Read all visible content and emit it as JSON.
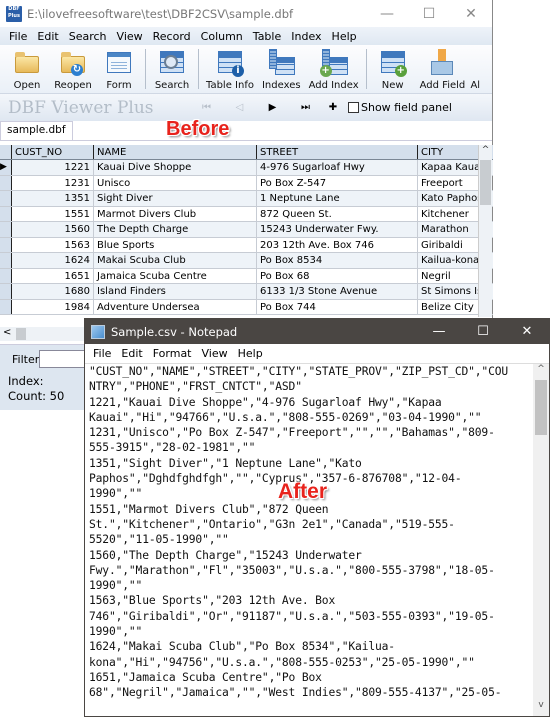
{
  "dbf_window": {
    "title": "E:\\ilovefreesoftware\\test\\DBF2CSV\\sample.dbf",
    "app_icon_text": "DBF Plus",
    "controls": {
      "minimize": "—",
      "maximize": "☐",
      "close": "✕"
    },
    "menu": [
      "File",
      "Edit",
      "Search",
      "View",
      "Record",
      "Column",
      "Table",
      "Index",
      "Help"
    ],
    "toolbar": [
      {
        "label": "Open",
        "icon": "folder-open-icon"
      },
      {
        "label": "Reopen",
        "icon": "folder-reopen-icon"
      },
      {
        "label": "Form",
        "icon": "form-icon"
      },
      {
        "label": "Search",
        "icon": "search-table-icon"
      },
      {
        "label": "Table Info",
        "icon": "table-info-icon"
      },
      {
        "label": "Indexes",
        "icon": "indexes-icon"
      },
      {
        "label": "Add Index",
        "icon": "add-index-icon"
      },
      {
        "label": "New",
        "icon": "new-table-icon"
      },
      {
        "label": "Add Field",
        "icon": "add-field-icon"
      },
      {
        "label": "Al",
        "icon": ""
      }
    ],
    "brand": "DBF Viewer Plus",
    "nav": {
      "first": "⏮",
      "prev": "◁",
      "next": "▶",
      "last": "⏭",
      "add": "✚"
    },
    "show_field_panel": {
      "label": "Show field panel",
      "checked": false
    },
    "tab": "sample.dbf",
    "annotation": "Before",
    "grid": {
      "columns": [
        "CUST_NO",
        "NAME",
        "STREET",
        "CITY"
      ],
      "rows": [
        [
          "1221",
          "Kauai Dive Shoppe",
          "4-976 Sugarloaf Hwy",
          "Kapaa Kauai"
        ],
        [
          "1231",
          "Unisco",
          "Po Box Z-547",
          "Freeport"
        ],
        [
          "1351",
          "Sight Diver",
          "1 Neptune Lane",
          "Kato Paphos"
        ],
        [
          "1551",
          "Marmot Divers Club",
          "872 Queen St.",
          "Kitchener"
        ],
        [
          "1560",
          "The Depth Charge",
          "15243 Underwater Fwy.",
          "Marathon"
        ],
        [
          "1563",
          "Blue Sports",
          "203 12th Ave. Box 746",
          "Giribaldi"
        ],
        [
          "1624",
          "Makai Scuba Club",
          "Po Box 8534",
          "Kailua-kona"
        ],
        [
          "1651",
          "Jamaica Scuba Centre",
          "Po Box 68",
          "Negril"
        ],
        [
          "1680",
          "Island Finders",
          "6133 1/3 Stone Avenue",
          "St Simons Isle"
        ],
        [
          "1984",
          "Adventure Undersea",
          "Po Box 744",
          "Belize City"
        ]
      ],
      "current_row_marker": "▶"
    },
    "filter_label": "Filter",
    "filter_value": "",
    "status": {
      "index": "Index:",
      "count": "Count: 50"
    }
  },
  "notepad": {
    "title": "Sample.csv - Notepad",
    "controls": {
      "minimize": "—",
      "maximize": "☐",
      "close": "✕"
    },
    "menu": [
      "File",
      "Edit",
      "Format",
      "View",
      "Help"
    ],
    "annotation": "After",
    "lines": [
      "\"CUST_NO\",\"NAME\",\"STREET\",\"CITY\",\"STATE_PROV\",\"ZIP_PST_CD\",\"COU",
      "NTRY\",\"PHONE\",\"FRST_CNTCT\",\"ASD\"",
      "1221,\"Kauai Dive Shoppe\",\"4-976 Sugarloaf Hwy\",\"Kapaa",
      "Kauai\",\"Hi\",\"94766\",\"U.s.a.\",\"808-555-0269\",\"03-04-1990\",\"\"",
      "1231,\"Unisco\",\"Po Box Z-547\",\"Freeport\",\"\",\"\",\"Bahamas\",\"809-",
      "555-3915\",\"28-02-1981\",\"\"",
      "1351,\"Sight Diver\",\"1 Neptune Lane\",\"Kato",
      "Paphos\",\"Dghdfghdfgh\",\"\",\"Cyprus\",\"357-6-876708\",\"12-04-",
      "1990\",\"\"",
      "1551,\"Marmot Divers Club\",\"872 Queen",
      "St.\",\"Kitchener\",\"Ontario\",\"G3n 2e1\",\"Canada\",\"519-555-",
      "5520\",\"11-05-1990\",\"\"",
      "1560,\"The Depth Charge\",\"15243 Underwater",
      "Fwy.\",\"Marathon\",\"Fl\",\"35003\",\"U.s.a.\",\"800-555-3798\",\"18-05-",
      "1990\",\"\"",
      "1563,\"Blue Sports\",\"203 12th Ave. Box",
      "746\",\"Giribaldi\",\"Or\",\"91187\",\"U.s.a.\",\"503-555-0393\",\"19-05-",
      "1990\",\"\"",
      "1624,\"Makai Scuba Club\",\"Po Box 8534\",\"Kailua-",
      "kona\",\"Hi\",\"94756\",\"U.s.a.\",\"808-555-0253\",\"25-05-1990\",\"\"",
      "1651,\"Jamaica Scuba Centre\",\"Po Box",
      "68\",\"Negril\",\"Jamaica\",\"\",\"West Indies\",\"809-555-4137\",\"25-05-"
    ]
  }
}
